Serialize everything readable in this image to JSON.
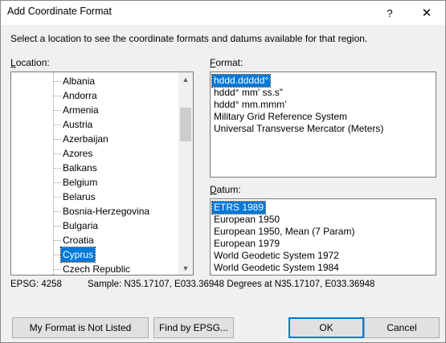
{
  "window": {
    "title": "Add Coordinate Format",
    "help_glyph": "?",
    "close_glyph": "✕"
  },
  "instructions": "Select a location to see the coordinate formats and datums available for that region.",
  "location": {
    "label_underline": "L",
    "label_rest": "ocation:",
    "items": [
      "Albania",
      "Andorra",
      "Armenia",
      "Austria",
      "Azerbaijan",
      "Azores",
      "Balkans",
      "Belgium",
      "Belarus",
      "Bosnia-Herzegovina",
      "Bulgaria",
      "Croatia",
      "Cyprus",
      "Czech Republic"
    ],
    "selected": "Cyprus"
  },
  "format": {
    "label_underline": "F",
    "label_rest": "ormat:",
    "items": [
      "hddd.ddddd°",
      "hddd° mm' ss.s\"",
      "hddd° mm.mmm'",
      "Military Grid Reference System",
      "Universal Transverse Mercator (Meters)"
    ],
    "selected": "hddd.ddddd°"
  },
  "datum": {
    "label_underline": "D",
    "label_rest": "atum:",
    "items": [
      "ETRS 1989",
      "European 1950",
      "European 1950, Mean (7 Param)",
      "European 1979",
      "World Geodetic System 1972",
      "World Geodetic System 1984"
    ],
    "selected": "ETRS 1989"
  },
  "status": {
    "epsg": "EPSG: 4258",
    "sample": "Sample: N35.17107, E033.36948 Degrees at N35.17107, E033.36948"
  },
  "buttons": {
    "not_listed": "My Format is Not Listed",
    "find_epsg": "Find by EPSG...",
    "ok": "OK",
    "cancel": "Cancel"
  },
  "icons": {
    "scroll_up": "▲",
    "scroll_down": "▼"
  },
  "colors": {
    "selection": "#0078d7",
    "dialog_bg": "#f0f0f0"
  }
}
